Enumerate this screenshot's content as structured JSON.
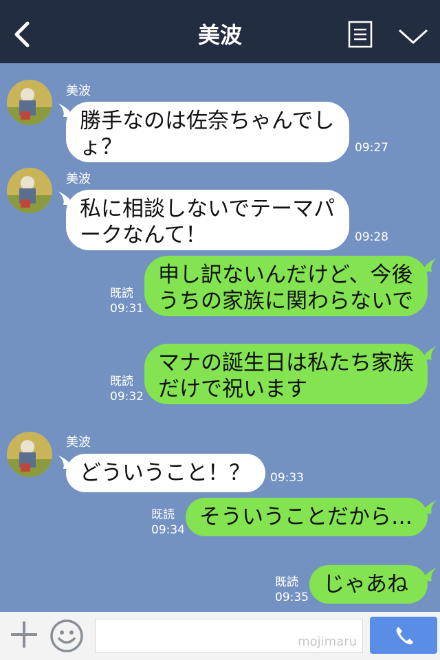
{
  "header": {
    "title": "美波",
    "back_icon": "chevron-left-icon",
    "menu_icon": "note-icon",
    "collapse_icon": "chevron-down-icon"
  },
  "messages": [
    {
      "side": "left",
      "sender": "美波",
      "text": [
        "勝手なのは佐奈ちゃんでし",
        "ょ？"
      ],
      "time": "09:27"
    },
    {
      "side": "left",
      "sender": "美波",
      "text": [
        "私に相談しないでテーマパ",
        "ークなんて！"
      ],
      "time": "09:28"
    },
    {
      "side": "right",
      "read": "既読",
      "text": [
        "申し訳ないんだけど、今後",
        "うちの家族に関わらないで"
      ],
      "time": "09:31"
    },
    {
      "side": "right",
      "read": "既読",
      "text": [
        "マナの誕生日は私たち家族",
        "だけで祝います"
      ],
      "time": "09:32"
    },
    {
      "side": "left",
      "sender": "美波",
      "text": [
        "どういうこと！？"
      ],
      "time": "09:33"
    },
    {
      "side": "right",
      "read": "既読",
      "text": [
        "そういうことだから…"
      ],
      "time": "09:34"
    },
    {
      "side": "right",
      "read": "既読",
      "text": [
        "じゃあね"
      ],
      "time": "09:35"
    }
  ],
  "input_bar": {
    "watermark": "mojimaru",
    "plus_icon": "plus-icon",
    "emoji_icon": "smiley-icon",
    "send_icon": "phone-icon"
  },
  "colors": {
    "header_bg": "#232d41",
    "chat_bg": "#7392c2",
    "left_bubble": "#ffffff",
    "right_bubble": "#84e351",
    "send_button": "#5a8ee6"
  }
}
